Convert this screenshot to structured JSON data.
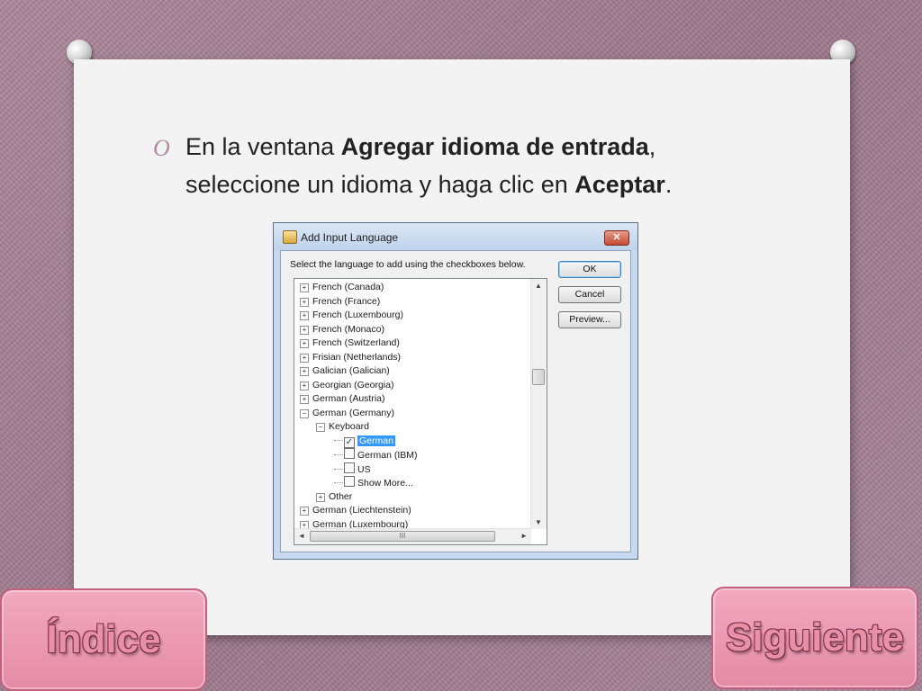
{
  "slide": {
    "text_before_1": "En la ventana ",
    "text_bold_1": "Agregar idioma de entrada",
    "text_after_1": ",",
    "text_before_2": "seleccione un idioma y haga clic en ",
    "text_bold_2": "Aceptar",
    "text_after_2": ".",
    "bullet_mark": "O"
  },
  "dialog": {
    "title": "Add Input Language",
    "close_glyph": "✕",
    "instructions": "Select the language to add using the checkboxes below.",
    "buttons": {
      "ok": "OK",
      "cancel": "Cancel",
      "preview": "Preview..."
    },
    "scroll_up": "▲",
    "scroll_down": "▼",
    "scroll_left": "◄",
    "scroll_right": "►",
    "hscroll_thumb_grip": "III",
    "tree": {
      "items": [
        "French (Canada)",
        "French (France)",
        "French (Luxembourg)",
        "French (Monaco)",
        "French (Switzerland)",
        "Frisian (Netherlands)",
        "Galician (Galician)",
        "Georgian (Georgia)",
        "German (Austria)",
        "German (Germany)"
      ],
      "keyboard_label": "Keyboard",
      "keyboard_items": [
        {
          "label": "German",
          "checked": true,
          "selected": true
        },
        {
          "label": "German (IBM)",
          "checked": false
        },
        {
          "label": "US",
          "checked": false
        },
        {
          "label": "Show More...",
          "checked": false
        }
      ],
      "other_label": "Other",
      "after_items": [
        "German (Liechtenstein)",
        "German (Luxembourg)"
      ]
    }
  },
  "nav": {
    "index_label": "Índice",
    "next_label": "Siguiente"
  }
}
